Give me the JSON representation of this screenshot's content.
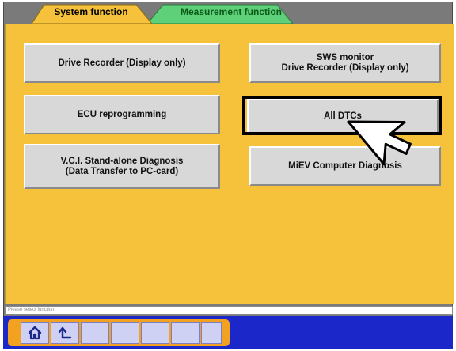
{
  "tabs": [
    {
      "label": "System function",
      "active": true,
      "color": "#f7c23b"
    },
    {
      "label": "Measurement function",
      "active": false,
      "color": "#5ed07a"
    }
  ],
  "buttons": {
    "drive_recorder": "Drive Recorder (Display only)",
    "sws_monitor": "SWS monitor\nDrive Recorder (Display only)",
    "ecu_reprogramming": "ECU reprogramming",
    "all_dtcs": "All DTCs",
    "vci_standalone": "V.C.I. Stand-alone Diagnosis\n(Data Transfer to PC-card)",
    "miev_diagnosis": "MiEV Computer Diagnosis"
  },
  "selected_button": "All DTCs",
  "status_text": "Please select function.",
  "toolbar": {
    "home_icon": "home-icon",
    "back_icon": "return-arrow-icon",
    "bar_color": "#1b27c9",
    "accent_color": "#f3a120"
  }
}
